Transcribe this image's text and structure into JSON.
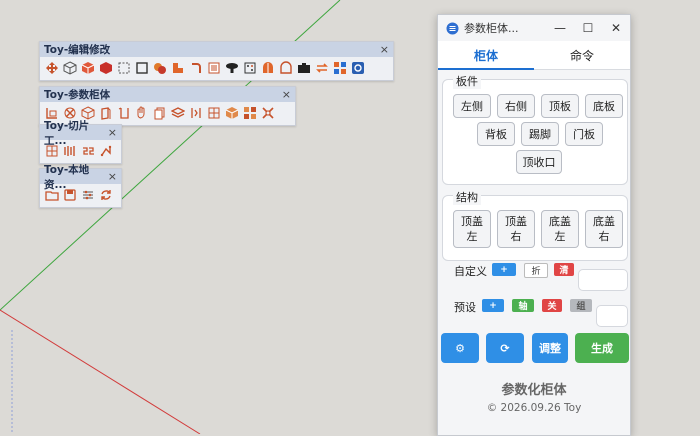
{
  "toolbars": {
    "edit": {
      "title": "Toy-编辑修改",
      "close": "×"
    },
    "cabinet": {
      "title": "Toy-参数柜体",
      "close": "×"
    },
    "slice": {
      "title": "Toy-切片工...",
      "close": "×"
    },
    "local": {
      "title": "Toy-本地资...",
      "close": "×"
    }
  },
  "panel": {
    "title": "参数柜体...",
    "window": {
      "minimize": "—",
      "maximize": "☐",
      "close": "✕"
    },
    "tabs": [
      {
        "label": "柜体"
      },
      {
        "label": "命令"
      }
    ],
    "panels_group": {
      "title": "板件",
      "buttons": [
        "左侧",
        "右侧",
        "顶板",
        "底板",
        "背板",
        "踢脚",
        "门板",
        "顶收口"
      ]
    },
    "structure_group": {
      "title": "结构",
      "buttons": [
        "顶盖\n左",
        "顶盖\n右",
        "底盖\n左",
        "底盖\n右"
      ]
    },
    "custom": {
      "label": "自定义",
      "add": "+",
      "fold": "折",
      "clear": "清"
    },
    "preset": {
      "label": "预设",
      "add": "+",
      "axis": "轴",
      "close": "关",
      "group": "组"
    },
    "actions": {
      "settings": "⚙",
      "refresh": "⟳",
      "adjust": "调整",
      "generate": "生成"
    },
    "footer": {
      "title": "参数化柜体",
      "copyright": "© 2026.09.26 Toy"
    }
  },
  "colors": {
    "accent_blue": "#2f8fe6",
    "green": "#4cb050",
    "red": "#e04545",
    "gray": "#a5a8ad"
  }
}
